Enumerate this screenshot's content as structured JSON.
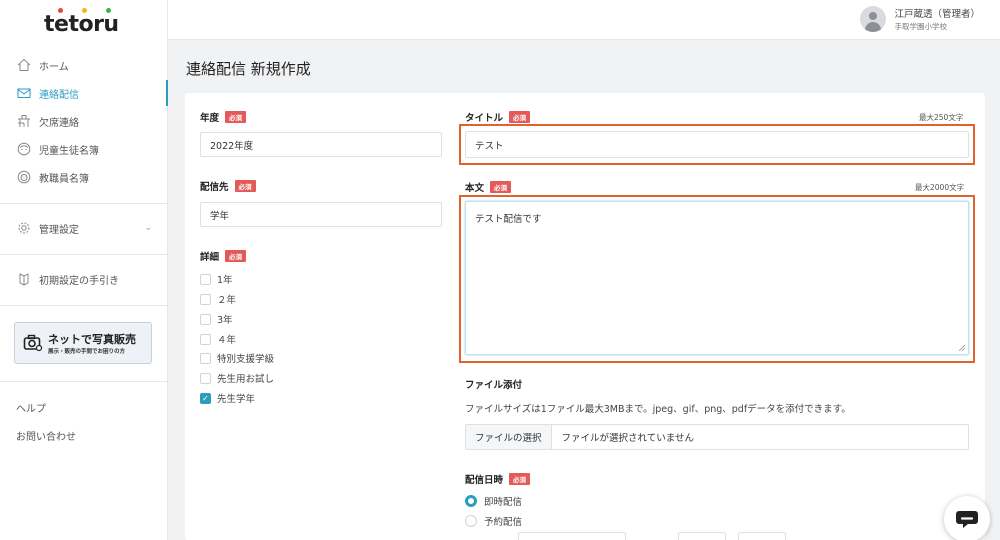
{
  "brand": {
    "logo": "tetoru",
    "dot_colors": [
      "#e4493f",
      "#f2b51c",
      "#3ab34a"
    ]
  },
  "accent": "#2b9ec0",
  "highlight_color": "#e0622f",
  "required_color": "#e45a5a",
  "sidebar": {
    "items": [
      {
        "label": "ホーム",
        "icon": "home-icon",
        "active": false
      },
      {
        "label": "連絡配信",
        "icon": "mail-icon",
        "active": true
      },
      {
        "label": "欠席連絡",
        "icon": "desk-icon",
        "active": false
      },
      {
        "label": "児童生徒名簿",
        "icon": "student-face-icon",
        "active": false
      },
      {
        "label": "教職員名簿",
        "icon": "teacher-face-icon",
        "active": false
      }
    ],
    "settings": {
      "label": "管理設定",
      "icon": "gear-icon"
    },
    "guide": {
      "label": "初期設定の手引き",
      "icon": "book-icon"
    },
    "photo_banner": {
      "title": "ネットで写真販売",
      "subtitle": "展示・販売の手間でお困りの方"
    },
    "help": "ヘルプ",
    "contact": "お問い合わせ"
  },
  "header": {
    "user_name": "江戸蔵透（管理者）",
    "school": "手取学園小学校"
  },
  "page": {
    "title": "連絡配信 新規作成"
  },
  "form": {
    "required_label": "必須",
    "year": {
      "label": "年度",
      "value": "2022年度"
    },
    "target": {
      "label": "配信先",
      "value": "学年"
    },
    "detail": {
      "label": "詳細",
      "options": [
        {
          "label": "1年",
          "checked": false
        },
        {
          "label": "２年",
          "checked": false
        },
        {
          "label": "3年",
          "checked": false
        },
        {
          "label": "４年",
          "checked": false
        },
        {
          "label": "特別支援学級",
          "checked": false
        },
        {
          "label": "先生用お試し",
          "checked": false
        },
        {
          "label": "先生学年",
          "checked": true
        }
      ]
    },
    "title": {
      "label": "タイトル",
      "max": "最大250文字",
      "value": "テスト"
    },
    "body": {
      "label": "本文",
      "max": "最大2000文字",
      "value": "テスト配信です"
    },
    "attachment": {
      "label": "ファイル添付",
      "description": "ファイルサイズは1ファイル最大3MBまで。jpeg、gif、png、pdfデータを添付できます。",
      "button": "ファイルの選択",
      "status": "ファイルが選択されていません"
    },
    "schedule": {
      "label": "配信日時",
      "options": [
        {
          "label": "即時配信",
          "selected": true
        },
        {
          "label": "予約配信",
          "selected": false
        }
      ]
    }
  },
  "chat_icon": "chat-bubble-icon"
}
